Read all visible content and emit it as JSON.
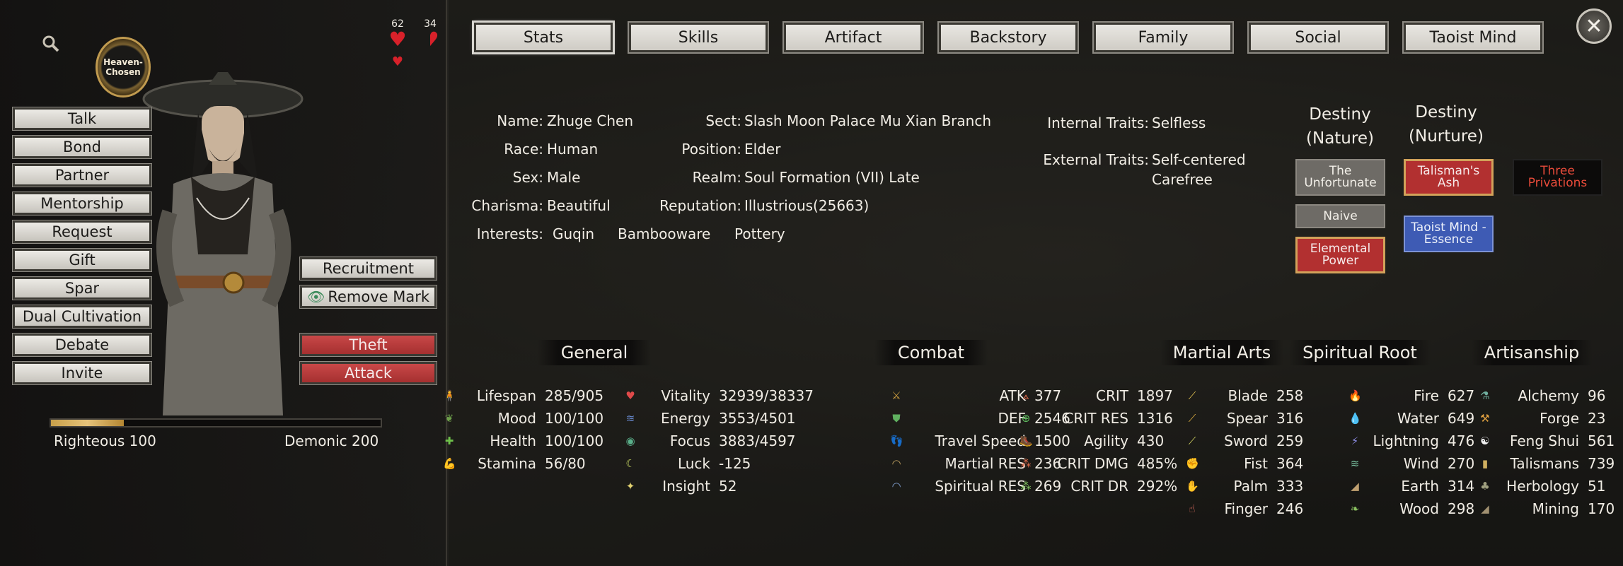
{
  "tabs": [
    "Stats",
    "Skills",
    "Artifact",
    "Backstory",
    "Family",
    "Social",
    "Taoist Mind"
  ],
  "close_label": "✕",
  "badge_text": "Heaven-Chosen",
  "hearts": {
    "left": "62",
    "right": "34"
  },
  "actions": [
    "Talk",
    "Bond",
    "Partner",
    "Mentorship",
    "Request",
    "Gift",
    "Spar",
    "Dual Cultivation",
    "Debate",
    "Invite"
  ],
  "side_actions": {
    "recruitment": "Recruitment",
    "remove_mark": "Remove Mark",
    "theft": "Theft",
    "attack": "Attack"
  },
  "alignment": {
    "righteous": "Righteous 100",
    "demonic": "Demonic 200",
    "fill_fraction": 0.22
  },
  "info": {
    "name_label": "Name:",
    "name": "Zhuge Chen",
    "race_label": "Race:",
    "race": "Human",
    "sex_label": "Sex:",
    "sex": "Male",
    "charisma_label": "Charisma:",
    "charisma": "Beautiful",
    "interests_label": "Interests:",
    "interests": [
      "Guqin",
      "Bambooware",
      "Pottery"
    ],
    "sect_label": "Sect:",
    "sect": "Slash Moon Palace Mu Xian Branch",
    "position_label": "Position:",
    "position": "Elder",
    "realm_label": "Realm:",
    "realm": "Soul Formation (VII) Late",
    "reputation_label": "Reputation:",
    "reputation": "Illustrious(25663)",
    "internal_label": "Internal Traits:",
    "internal": "Selfless",
    "external_label": "External Traits:",
    "external": [
      "Self-centered",
      "Carefree"
    ]
  },
  "destiny": {
    "nature_title": [
      "Destiny",
      "(Nature)"
    ],
    "nurture_title": [
      "Destiny",
      "(Nurture)"
    ],
    "nature_cards": [
      {
        "label": "The Unfortunate",
        "style": "gray"
      },
      {
        "label": "Naive",
        "style": "gray"
      },
      {
        "label": "Elemental Power",
        "style": "red"
      }
    ],
    "nurture_cards": [
      {
        "label": "Talisman's Ash",
        "style": "red"
      },
      {
        "label": "Three Privations",
        "style": "black"
      },
      {
        "label": "Taoist Mind - Essence",
        "style": "blue"
      }
    ]
  },
  "sections": {
    "general": "General",
    "combat": "Combat",
    "martial": "Martial Arts",
    "spiritual": "Spiritual Root",
    "artisanship": "Artisanship"
  },
  "general_a": [
    {
      "icon": "🧍",
      "color": "#d0a04a",
      "label": "Lifespan",
      "value": "285/905"
    },
    {
      "icon": "❦",
      "color": "#6ea04a",
      "label": "Mood",
      "value": "100/100"
    },
    {
      "icon": "✚",
      "color": "#6ec04a",
      "label": "Health",
      "value": "100/100"
    },
    {
      "icon": "💪",
      "color": "#d08a4a",
      "label": "Stamina",
      "value": "56/80"
    }
  ],
  "general_b": [
    {
      "icon": "♥",
      "color": "#e04a4a",
      "label": "Vitality",
      "value": "32939/38337"
    },
    {
      "icon": "≋",
      "color": "#6a8ad0",
      "label": "Energy",
      "value": "3553/4501"
    },
    {
      "icon": "◉",
      "color": "#5ab08a",
      "label": "Focus",
      "value": "3883/4597"
    },
    {
      "icon": "☾",
      "color": "#c0d060",
      "label": "Luck",
      "value": "-125"
    },
    {
      "icon": "✦",
      "color": "#e0d070",
      "label": "Insight",
      "value": "52"
    }
  ],
  "combat_a": [
    {
      "icon": "⚔",
      "color": "#d0a040",
      "label": "ATK",
      "value": "377"
    },
    {
      "icon": "⛊",
      "color": "#60b060",
      "label": "DEF",
      "value": "2546"
    },
    {
      "icon": "👣",
      "color": "#c08a5a",
      "label": "Travel Speed",
      "value": "1500"
    },
    {
      "icon": "◠",
      "color": "#c0a060",
      "label": "Martial RES",
      "value": "236"
    },
    {
      "icon": "◠",
      "color": "#80a0d0",
      "label": "Spiritual RES",
      "value": "269"
    }
  ],
  "combat_b": [
    {
      "icon": "⟑",
      "color": "#e06a4a",
      "label": "CRIT",
      "value": "1897"
    },
    {
      "icon": "⊕",
      "color": "#60c060",
      "label": "CRIT RES",
      "value": "1316"
    },
    {
      "icon": "🥾",
      "color": "#80b0b0",
      "label": "Agility",
      "value": "430"
    },
    {
      "icon": "⁂",
      "color": "#e06a4a",
      "label": "CRIT DMG",
      "value": "485%"
    },
    {
      "icon": "⁂",
      "color": "#80c060",
      "label": "CRIT DR",
      "value": "292%"
    }
  ],
  "martial": [
    {
      "icon": "⟋",
      "color": "#e0c050",
      "label": "Blade",
      "value": "258"
    },
    {
      "icon": "⟋",
      "color": "#e0b040",
      "label": "Spear",
      "value": "316"
    },
    {
      "icon": "⟋",
      "color": "#d0d060",
      "label": "Sword",
      "value": "259"
    },
    {
      "icon": "✊",
      "color": "#e07050",
      "label": "Fist",
      "value": "364"
    },
    {
      "icon": "✋",
      "color": "#e07060",
      "label": "Palm",
      "value": "333"
    },
    {
      "icon": "☝",
      "color": "#e07060",
      "label": "Finger",
      "value": "246"
    }
  ],
  "spiritual": [
    {
      "icon": "🔥",
      "color": "#e05a3a",
      "label": "Fire",
      "value": "627"
    },
    {
      "icon": "💧",
      "color": "#5aa0e0",
      "label": "Water",
      "value": "649"
    },
    {
      "icon": "⚡",
      "color": "#8a8ae0",
      "label": "Lightning",
      "value": "476"
    },
    {
      "icon": "≋",
      "color": "#7ac0a0",
      "label": "Wind",
      "value": "270"
    },
    {
      "icon": "◢",
      "color": "#c0a070",
      "label": "Earth",
      "value": "314"
    },
    {
      "icon": "❧",
      "color": "#8ac060",
      "label": "Wood",
      "value": "298"
    }
  ],
  "artisan": [
    {
      "icon": "⚗",
      "color": "#70b0a0",
      "label": "Alchemy",
      "value": "96"
    },
    {
      "icon": "⚒",
      "color": "#e0a040",
      "label": "Forge",
      "value": "23"
    },
    {
      "icon": "☯",
      "color": "#f0f0f0",
      "label": "Feng Shui",
      "value": "561"
    },
    {
      "icon": "▮",
      "color": "#d0b060",
      "label": "Talismans",
      "value": "739"
    },
    {
      "icon": "♣",
      "color": "#a0a080",
      "label": "Herbology",
      "value": "51"
    },
    {
      "icon": "◢",
      "color": "#a09070",
      "label": "Mining",
      "value": "170"
    }
  ]
}
